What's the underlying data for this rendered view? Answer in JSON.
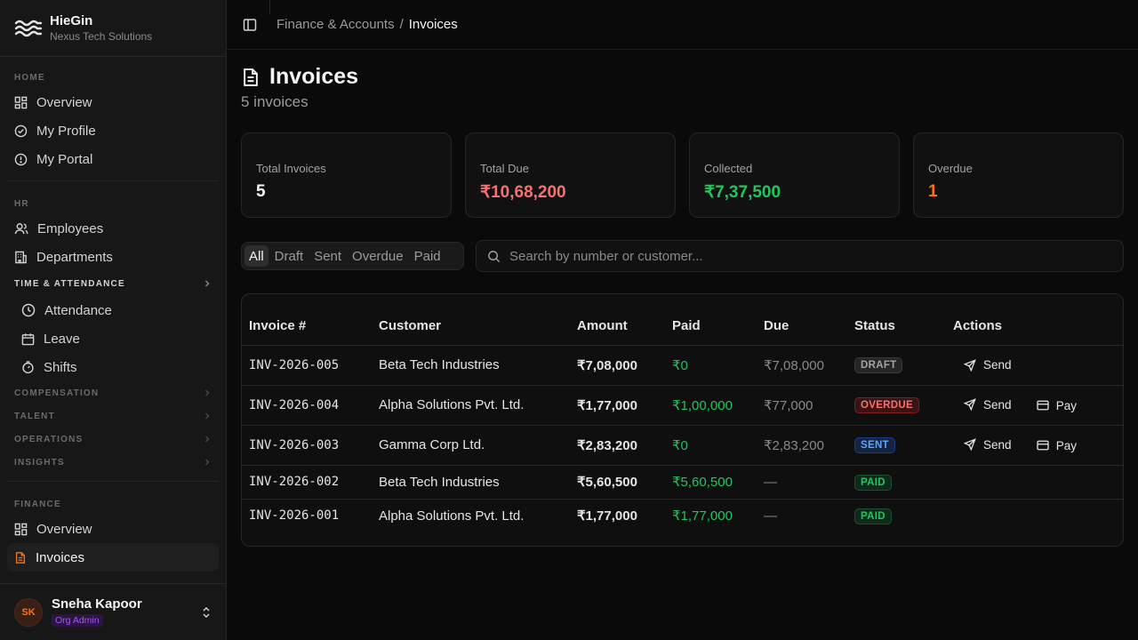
{
  "brand": {
    "name": "HieGin",
    "subtitle": "Nexus Tech Solutions"
  },
  "sidebar": {
    "home_label": "HOME",
    "home_items": [
      {
        "label": "Overview",
        "icon": "grid-icon"
      },
      {
        "label": "My Profile",
        "icon": "check-circle-icon"
      },
      {
        "label": "My Portal",
        "icon": "alert-circle-icon"
      }
    ],
    "hr_label": "HR",
    "hr_items": [
      {
        "label": "Employees",
        "icon": "users-icon"
      },
      {
        "label": "Departments",
        "icon": "building-icon"
      }
    ],
    "time_label": "TIME & ATTENDANCE",
    "time_items": [
      {
        "label": "Attendance",
        "icon": "clock-icon"
      },
      {
        "label": "Leave",
        "icon": "calendar-icon"
      },
      {
        "label": "Shifts",
        "icon": "timer-icon"
      }
    ],
    "groups": [
      "COMPENSATION",
      "TALENT",
      "OPERATIONS",
      "INSIGHTS"
    ],
    "finance_label": "FINANCE",
    "finance_items": [
      {
        "label": "Overview",
        "icon": "grid-icon"
      },
      {
        "label": "Invoices",
        "icon": "file-text-icon",
        "active": true
      }
    ]
  },
  "user": {
    "initials": "SK",
    "name": "Sneha Kapoor",
    "role": "Org Admin"
  },
  "breadcrumb": {
    "parent": "Finance & Accounts",
    "separator": "/",
    "current": "Invoices"
  },
  "page": {
    "title": "Invoices",
    "subtitle": "5 invoices"
  },
  "stats": [
    {
      "label": "Total Invoices",
      "value": "5",
      "color": "#f5f5f5"
    },
    {
      "label": "Total Due",
      "value": "₹10,68,200",
      "color": "#f87171"
    },
    {
      "label": "Collected",
      "value": "₹7,37,500",
      "color": "#22c55e"
    },
    {
      "label": "Overdue",
      "value": "1",
      "color": "#f97316"
    }
  ],
  "filters": {
    "tabs": [
      "All",
      "Draft",
      "Sent",
      "Overdue",
      "Paid"
    ],
    "active": "All"
  },
  "search": {
    "placeholder": "Search by number or customer..."
  },
  "table": {
    "headers": [
      "Invoice #",
      "Customer",
      "Amount",
      "Paid",
      "Due",
      "Status",
      "Actions"
    ],
    "rows": [
      {
        "number": "INV-2026-005",
        "customer": "Beta Tech Industries",
        "amount": "₹7,08,000",
        "paid": "₹0",
        "due": "₹7,08,000",
        "status": "DRAFT",
        "actions": [
          "Send"
        ]
      },
      {
        "number": "INV-2026-004",
        "customer": "Alpha Solutions Pvt. Ltd.",
        "amount": "₹1,77,000",
        "paid": "₹1,00,000",
        "due": "₹77,000",
        "status": "OVERDUE",
        "actions": [
          "Send",
          "Pay"
        ]
      },
      {
        "number": "INV-2026-003",
        "customer": "Gamma Corp Ltd.",
        "amount": "₹2,83,200",
        "paid": "₹0",
        "due": "₹2,83,200",
        "status": "SENT",
        "actions": [
          "Send",
          "Pay"
        ]
      },
      {
        "number": "INV-2026-002",
        "customer": "Beta Tech Industries",
        "amount": "₹5,60,500",
        "paid": "₹5,60,500",
        "due": "—",
        "status": "PAID",
        "actions": []
      },
      {
        "number": "INV-2026-001",
        "customer": "Alpha Solutions Pvt. Ltd.",
        "amount": "₹1,77,000",
        "paid": "₹1,77,000",
        "due": "—",
        "status": "PAID",
        "actions": []
      }
    ]
  },
  "status_colors": {
    "DRAFT": {
      "fg": "#a3a3a3",
      "bg": "#262626",
      "border": "#3a3a3a"
    },
    "OVERDUE": {
      "fg": "#f87171",
      "bg": "#3a1414",
      "border": "#7f1d1d"
    },
    "SENT": {
      "fg": "#60a5fa",
      "bg": "#132340",
      "border": "#1e3a8a"
    },
    "PAID": {
      "fg": "#22c55e",
      "bg": "#0f2a1a",
      "border": "#14532d"
    }
  }
}
